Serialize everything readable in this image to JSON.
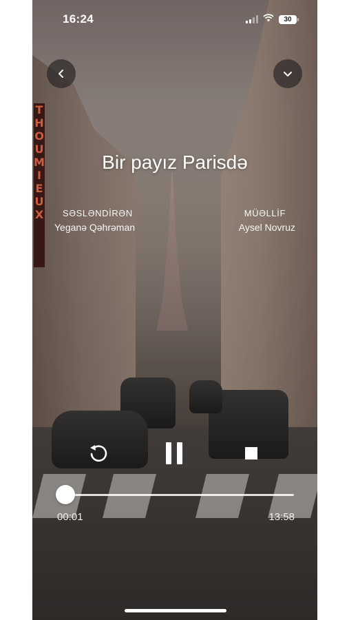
{
  "status_bar": {
    "time": "16:24",
    "battery": "30",
    "icons": [
      "cellular-signal-icon",
      "wifi-icon",
      "battery-icon"
    ]
  },
  "header": {
    "back_icon": "chevron-left-icon",
    "collapse_icon": "chevron-down-icon"
  },
  "cover": {
    "sign_text": "THOUMIEUX"
  },
  "book": {
    "title": "Bir payız Parisdə",
    "narrator_label": "SƏSLƏNDİRƏN",
    "narrator": "Yeganə Qəhrəman",
    "author_label": "MÜƏLLİF",
    "author": "Aysel Novruz"
  },
  "player": {
    "state": "playing",
    "controls": [
      "replay-icon",
      "pause-icon",
      "stop-icon"
    ],
    "elapsed": "00:01",
    "duration": "13:58",
    "progress": 0.0
  },
  "colors": {
    "text": "#ffffff",
    "button_bg": "#2d2828",
    "sign_text": "#e86a4a"
  }
}
